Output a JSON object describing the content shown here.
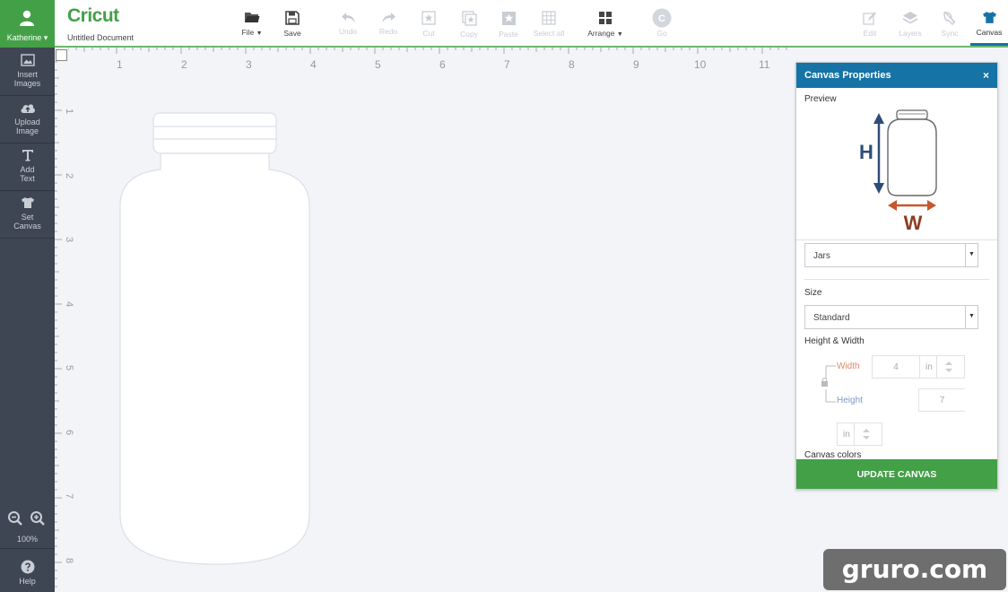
{
  "user": {
    "name": "Katherine",
    "caret": "▾"
  },
  "sidebar": {
    "items": [
      {
        "icon": "image-icon",
        "label_line1": "Insert",
        "label_line2": "Images"
      },
      {
        "icon": "cloud-upload-icon",
        "label_line1": "Upload",
        "label_line2": "Image"
      },
      {
        "icon": "text-icon",
        "label_line1": "Add",
        "label_line2": "Text"
      },
      {
        "icon": "tshirt-icon",
        "label_line1": "Set",
        "label_line2": "Canvas"
      }
    ],
    "zoom_level": "100%",
    "help_label": "Help"
  },
  "header": {
    "logo": "Cricut",
    "document_title": "Untitled Document",
    "tools": {
      "file": "File",
      "save": "Save",
      "undo": "Undo",
      "redo": "Redo",
      "cut": "Cut",
      "copy": "Copy",
      "paste": "Paste",
      "select_all": "Select all",
      "arrange": "Arrange",
      "go": "Go",
      "go_badge": "C",
      "edit": "Edit",
      "layers": "Layers",
      "sync": "Sync",
      "canvas": "Canvas"
    }
  },
  "rulers": {
    "top": [
      "1",
      "2",
      "3",
      "4",
      "5",
      "6",
      "7",
      "8",
      "9",
      "10",
      "11"
    ],
    "left": [
      "1",
      "2",
      "3",
      "4",
      "5",
      "6",
      "7",
      "8"
    ]
  },
  "panel": {
    "title": "Canvas Properties",
    "close": "×",
    "preview_label": "Preview",
    "preview_h": "H",
    "preview_w": "W",
    "canvas_type": "Jars",
    "size_label": "Size",
    "size_value": "Standard",
    "height_width_label": "Height & Width",
    "width_label": "Width",
    "width_value": "4",
    "width_unit": "in",
    "height_label": "Height",
    "height_value": "7",
    "unit_value": "in",
    "canvas_colors_label": "Canvas colors",
    "update_button": "UPDATE CANVAS"
  },
  "colors": {
    "brand_green": "#43a047",
    "accent_blue": "#1573a6",
    "sidebar_bg": "#3f4653",
    "width_label": "#e0876a",
    "height_label": "#7f9bc4"
  },
  "watermark": "gruro.com"
}
